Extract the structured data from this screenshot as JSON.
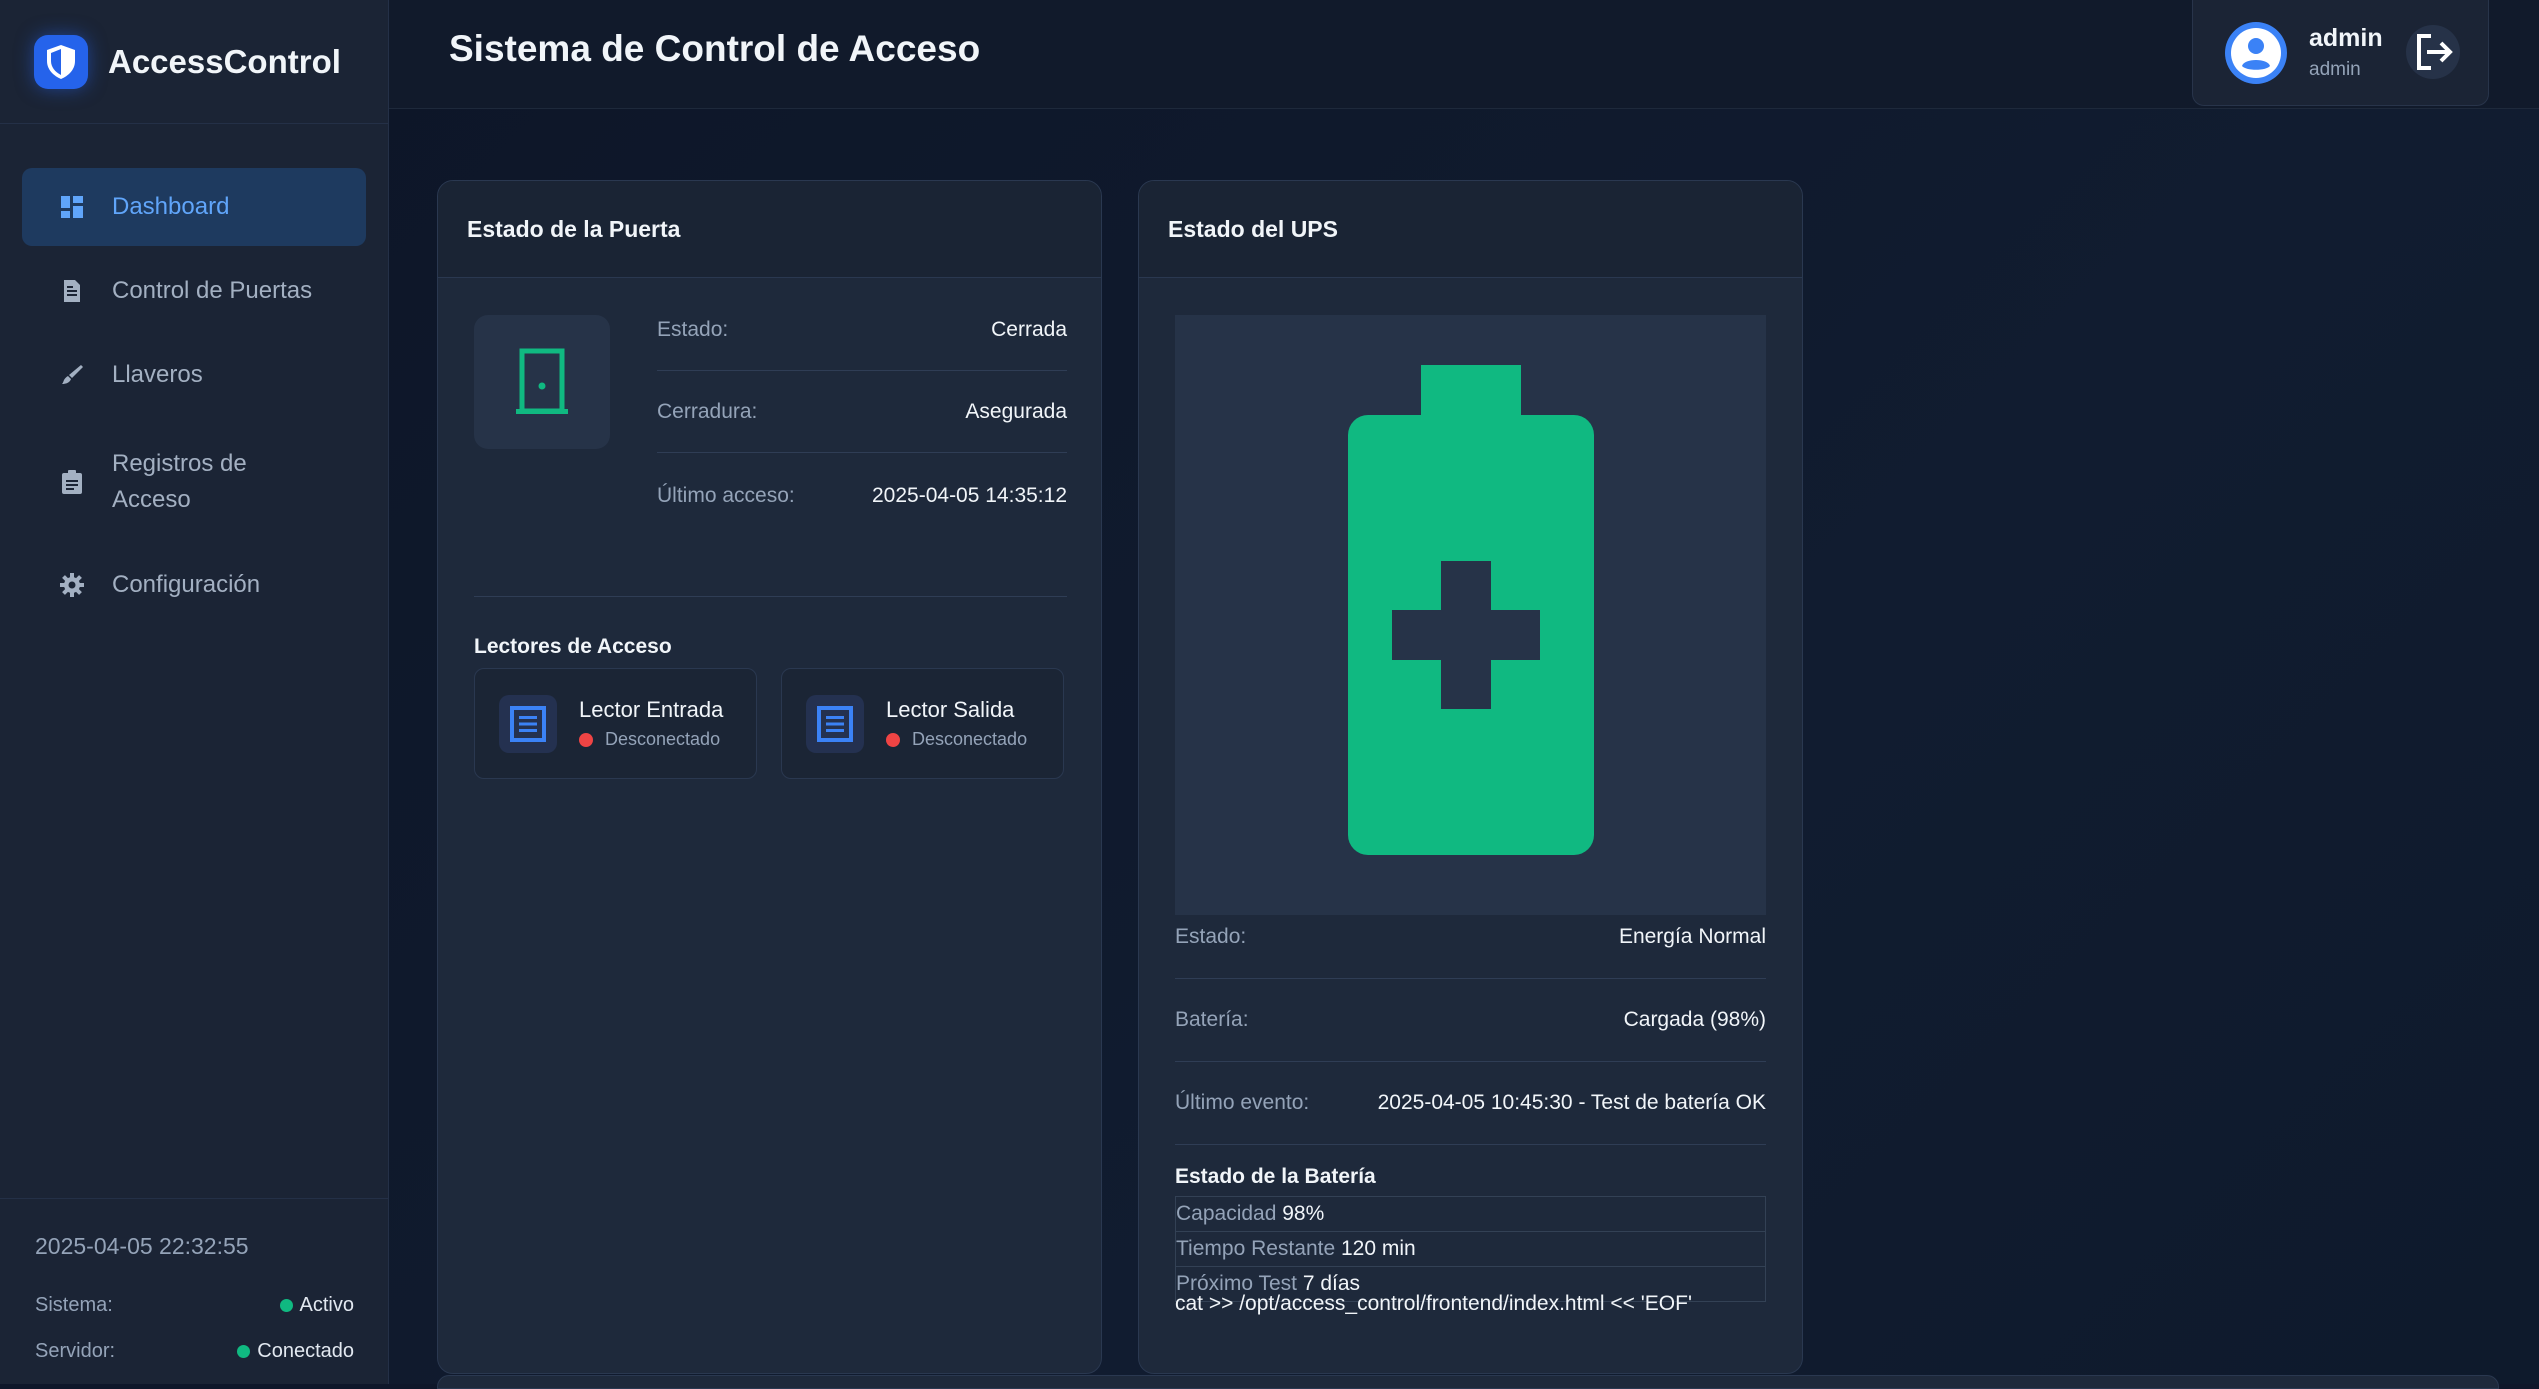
{
  "app": {
    "name": "AccessControl"
  },
  "sidebar": {
    "items": [
      {
        "label": "Dashboard",
        "icon": "dashboard-icon",
        "active": true
      },
      {
        "label": "Control de Puertas",
        "icon": "document-icon"
      },
      {
        "label": "Llaveros",
        "icon": "brush-icon"
      },
      {
        "label": "Registros de Acceso",
        "icon": "clipboard-icon"
      },
      {
        "label": "Configuración",
        "icon": "gear-icon"
      }
    ],
    "footer": {
      "datetime": "2025-04-05 22:32:55",
      "sistema_label": "Sistema:",
      "sistema_value": "Activo",
      "servidor_label": "Servidor:",
      "servidor_value": "Conectado"
    }
  },
  "header": {
    "title": "Sistema de Control de Acceso",
    "user": {
      "name": "admin",
      "role": "admin"
    }
  },
  "door": {
    "title": "Estado de la Puerta",
    "estado_label": "Estado:",
    "estado_value": "Cerrada",
    "cerradura_label": "Cerradura:",
    "cerradura_value": "Asegurada",
    "ultimo_label": "Último acceso:",
    "ultimo_value": "2025-04-05 14:35:12",
    "readers_title": "Lectores de Acceso",
    "readers": [
      {
        "name": "Lector Entrada",
        "status": "Desconectado"
      },
      {
        "name": "Lector Salida",
        "status": "Desconectado"
      }
    ]
  },
  "ups": {
    "title": "Estado del UPS",
    "estado_label": "Estado:",
    "estado_value": "Energía Normal",
    "bateria_label": "Batería:",
    "bateria_value": "Cargada (98%)",
    "evento_label": "Último evento:",
    "evento_value": "2025-04-05 10:45:30 - Test de batería OK",
    "battery_title": "Estado de la Batería",
    "capacidad_label": "Capacidad",
    "capacidad_value": "98%",
    "tiempo_label": "Tiempo Restante",
    "tiempo_value": "120 min",
    "test_label": "Próximo Test",
    "test_value": "7 días",
    "stray_text": "cat >> /opt/access_control/frontend/index.html << 'EOF'"
  },
  "colors": {
    "accent": "#3b82f6",
    "success": "#10b981",
    "danger": "#ef4444",
    "sidebar_bg": "#1b2435",
    "card_bg": "#1e293b"
  }
}
